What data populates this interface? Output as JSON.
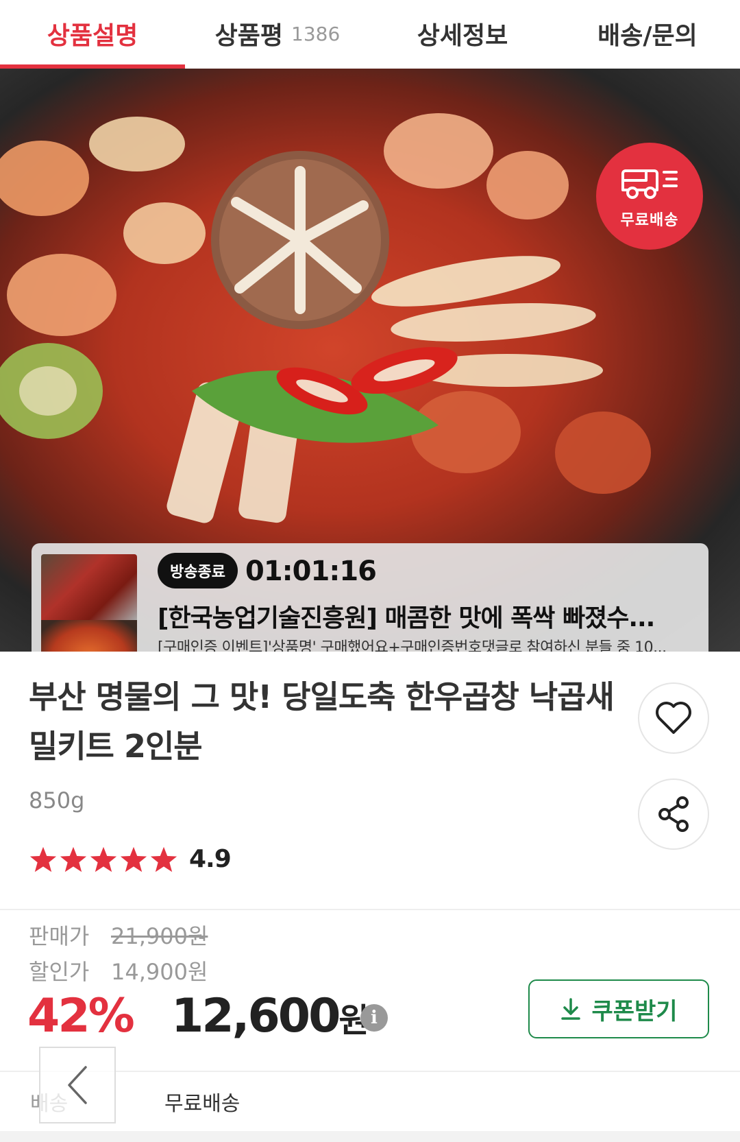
{
  "tabs": [
    {
      "label": "상품설명",
      "active": true
    },
    {
      "label": "상품평",
      "count": "1386"
    },
    {
      "label": "상세정보"
    },
    {
      "label": "배송/문의"
    }
  ],
  "hero": {
    "free_shipping_badge": "무료배송",
    "live": {
      "status": "방송종료",
      "countdown": "01:01:16",
      "title": "[한국농업기술진흥원] 매콤한 맛에 폭싹 빠졌수...",
      "description": "[구매인증 이벤트]'상품명' 구매했어요+구매인증번호댓글로 참여하신 분들 중 10..."
    }
  },
  "product": {
    "title": "부산 명물의 그 맛! 당일도축 한우곱창 낙곱새 밀키트 2인분",
    "weight": "850g",
    "rating": "4.9",
    "stars": 5
  },
  "price": {
    "list_label": "판매가",
    "list_price": "21,900원",
    "sale_label": "할인가",
    "sale_price": "14,900원",
    "discount": "42%",
    "final_price": "12,600",
    "final_unit": "원",
    "info_icon_glyph": "i",
    "coupon_label": "쿠폰받기"
  },
  "shipping": {
    "label": "배송",
    "value": "무료배송"
  },
  "colors": {
    "accent": "#e3313f",
    "coupon": "#1e8a4a"
  },
  "icons": {
    "wishlist": "heart-icon",
    "share": "share-icon",
    "back": "chevron-left-icon",
    "download": "download-icon",
    "truck": "truck-icon"
  }
}
